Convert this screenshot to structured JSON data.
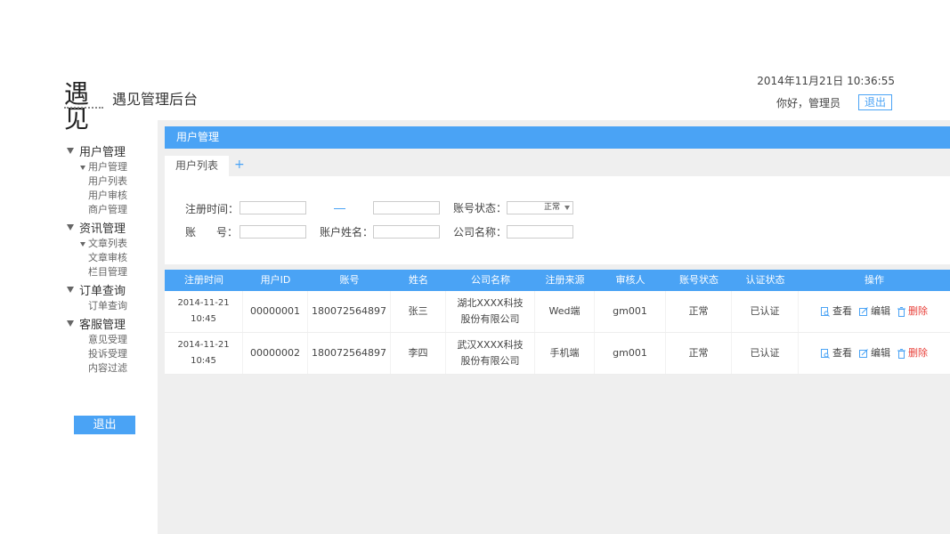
{
  "header": {
    "logo_text": "遇见",
    "title": "遇见管理后台",
    "datetime": "2014年11月21日 10:36:55",
    "greeting": "你好，管理员",
    "logout_label": "退出"
  },
  "sidebar": {
    "groups": [
      {
        "label": "用户管理",
        "sub_lead": "用户管理",
        "items": [
          "用户列表",
          "用户审核",
          "商户管理"
        ]
      },
      {
        "label": "资讯管理",
        "sub_lead": "文章列表",
        "items": [
          "文章审核",
          "栏目管理"
        ]
      },
      {
        "label": "订单查询",
        "items": [
          "订单查询"
        ]
      },
      {
        "label": "客服管理",
        "items": [
          "意见受理",
          "投诉受理",
          "内容过滤"
        ]
      }
    ],
    "logout_label": "退出"
  },
  "main": {
    "section_title": "用户管理",
    "tab_label": "用户列表",
    "tab_add": "+"
  },
  "filter": {
    "reg_time_label": "注册时间：",
    "account_status_label": "账号状态：",
    "account_status_value": "正常",
    "account_label_a": "账",
    "account_label_b": "号：",
    "account_name_label": "账户姓名：",
    "company_label": "公司名称："
  },
  "table": {
    "headers": [
      "注册时间",
      "用户ID",
      "账号",
      "姓名",
      "公司名称",
      "注册来源",
      "审核人",
      "账号状态",
      "认证状态",
      "操作"
    ],
    "rows": [
      {
        "reg_time": "2014-11-21  10:45",
        "user_id": "00000001",
        "account": "180072564897",
        "name": "张三",
        "company_l1": "湖北XXXX科技",
        "company_l2": "股份有限公司",
        "source": "Wed端",
        "reviewer": "gm001",
        "status": "正常",
        "cert": "已认证"
      },
      {
        "reg_time": "2014-11-21  10:45",
        "user_id": "00000002",
        "account": "180072564897",
        "name": "李四",
        "company_l1": "武汉XXXX科技",
        "company_l2": "股份有限公司",
        "source": "手机端",
        "reviewer": "gm001",
        "status": "正常",
        "cert": "已认证"
      }
    ],
    "actions": {
      "view": "查看",
      "edit": "编辑",
      "delete": "删除"
    }
  },
  "colors": {
    "accent": "#4aa3f5",
    "danger": "#e8413b",
    "panel_bg": "#efefef"
  }
}
